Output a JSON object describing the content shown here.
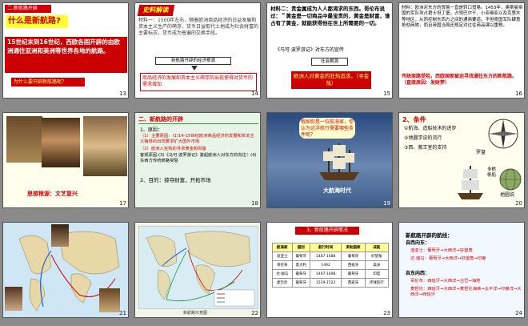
{
  "slides": [
    {
      "number": "13",
      "tag": "二.新航路开辟",
      "question": "什么是新航路?",
      "main_text": "15世纪末到16世纪，西欧各国开辟的由欧洲通往亚洲和美洲等世界各地的航路。",
      "ask": "为什么要开辟新航路呢？"
    },
    {
      "number": "14",
      "banner": "史料解读",
      "paragraph": "材料一：1500年左右，随着欧洲商品经济的日益发展和资本主义生产的萌芽，货币日益取代土地成为社会财富的主要标志，货币成为普遍的交换手段。",
      "flow_label": "新航路开辟的经济根源",
      "highlight": "商品经济的发展和资本主义萌芽的出现使得对货币的需求增加"
    },
    {
      "number": "15",
      "paragraph": "材料二：贵金属成为人人都渴求的东西。哥伦布说过：＂黄金是一切商品中最宝贵的，黄金是财富，谁占有了黄金，就能获得他在世上所需要的一切。",
      "source": "《马可·波罗游记》对东方的宣传",
      "market_label": "社会根源",
      "gold_text": "欧洲人对黄金的狂热追求。（寻金热）"
    },
    {
      "number": "16",
      "paragraph": "材料：欧洲对东方的贸易一直是转口贸易。1453年，奥斯曼帝国的军队攻占君士坦丁堡，占领巴尔干、小亚细亚以及克里木等地区，从而控制东西方之间的通商要道。不但奇国军队肆意抢劫商旅，而且帝国当局还规定对过往商品课以重税。",
      "conclusion": "传统商路受阻，西欧国家被迫寻找通往东方的新航路。（直接原因：发财梦）"
    },
    {
      "number": "17",
      "root_text": "思想根源：文艺复兴"
    },
    {
      "number": "18",
      "heading": "二、新航路的开辟",
      "item1": "1、原因：",
      "item1a": "（1）主要原因：(1)14-15世纪欧洲商品经济的发展和资本主义萌芽的出现要求扩大国外市场",
      "item1b": "（2）欧洲人狂热的寻求黄金和财富",
      "item1c": "客观原因:(3)《马可·波罗游记》激起欧洲人对东方的向往！(4)东西方传统商路受阻",
      "item2": "2、目的：掠夺财富，开拓市场"
    },
    {
      "number": "19",
      "bubble": "假如你是一位航海家，你认为远洋航行需要哪些条件呢？",
      "caption": "大航海时代"
    },
    {
      "number": "20",
      "heading": "2、条件",
      "c1": "①航海、造船技术的进步",
      "c2": "②地圆学说的流行",
      "c3": "③西、葡王室的支持",
      "compass_label": "罗盘",
      "ship_label": "多桅帆船",
      "globe_label": "地圆说"
    },
    {
      "number": "21"
    },
    {
      "number": "22",
      "map_caption": "新航路示意图"
    },
    {
      "number": "23",
      "heading": "3、新航路开辟情况",
      "table_headers": [
        "航海家",
        "国别",
        "航行时间",
        "资助国家",
        "成就"
      ],
      "table_rows": [
        [
          "迪亚士",
          "葡萄牙",
          "1487-1488",
          "葡萄牙",
          "好望角"
        ],
        [
          "哥伦布",
          "意大利",
          "1492",
          "西班牙",
          "美洲"
        ],
        [
          "达·伽马",
          "葡萄牙",
          "1497-1498",
          "葡萄牙",
          "印度"
        ],
        [
          "麦哲伦",
          "葡萄牙",
          "1519-1522",
          "西班牙",
          "环球航行"
        ]
      ]
    },
    {
      "number": "24",
      "heading": "新航路开辟的航线：",
      "east_title": "自西向东：",
      "east1": "迪亚士：葡萄牙→大西洋→好望角",
      "east2": "达·伽马：葡萄牙→大西洋→好望角→印度",
      "west_title": "自东向西：",
      "west1": "哥伦布：西班牙→大西洋→古巴→海地",
      "west2": "麦哲伦：西班牙→大西洋→麦哲伦海峡→太平洋→印度洋→大西洋→西班牙"
    }
  ],
  "colors": {
    "accent": "#cc0000",
    "highlight": "#ffff33",
    "bg": "#8a8a8a"
  }
}
